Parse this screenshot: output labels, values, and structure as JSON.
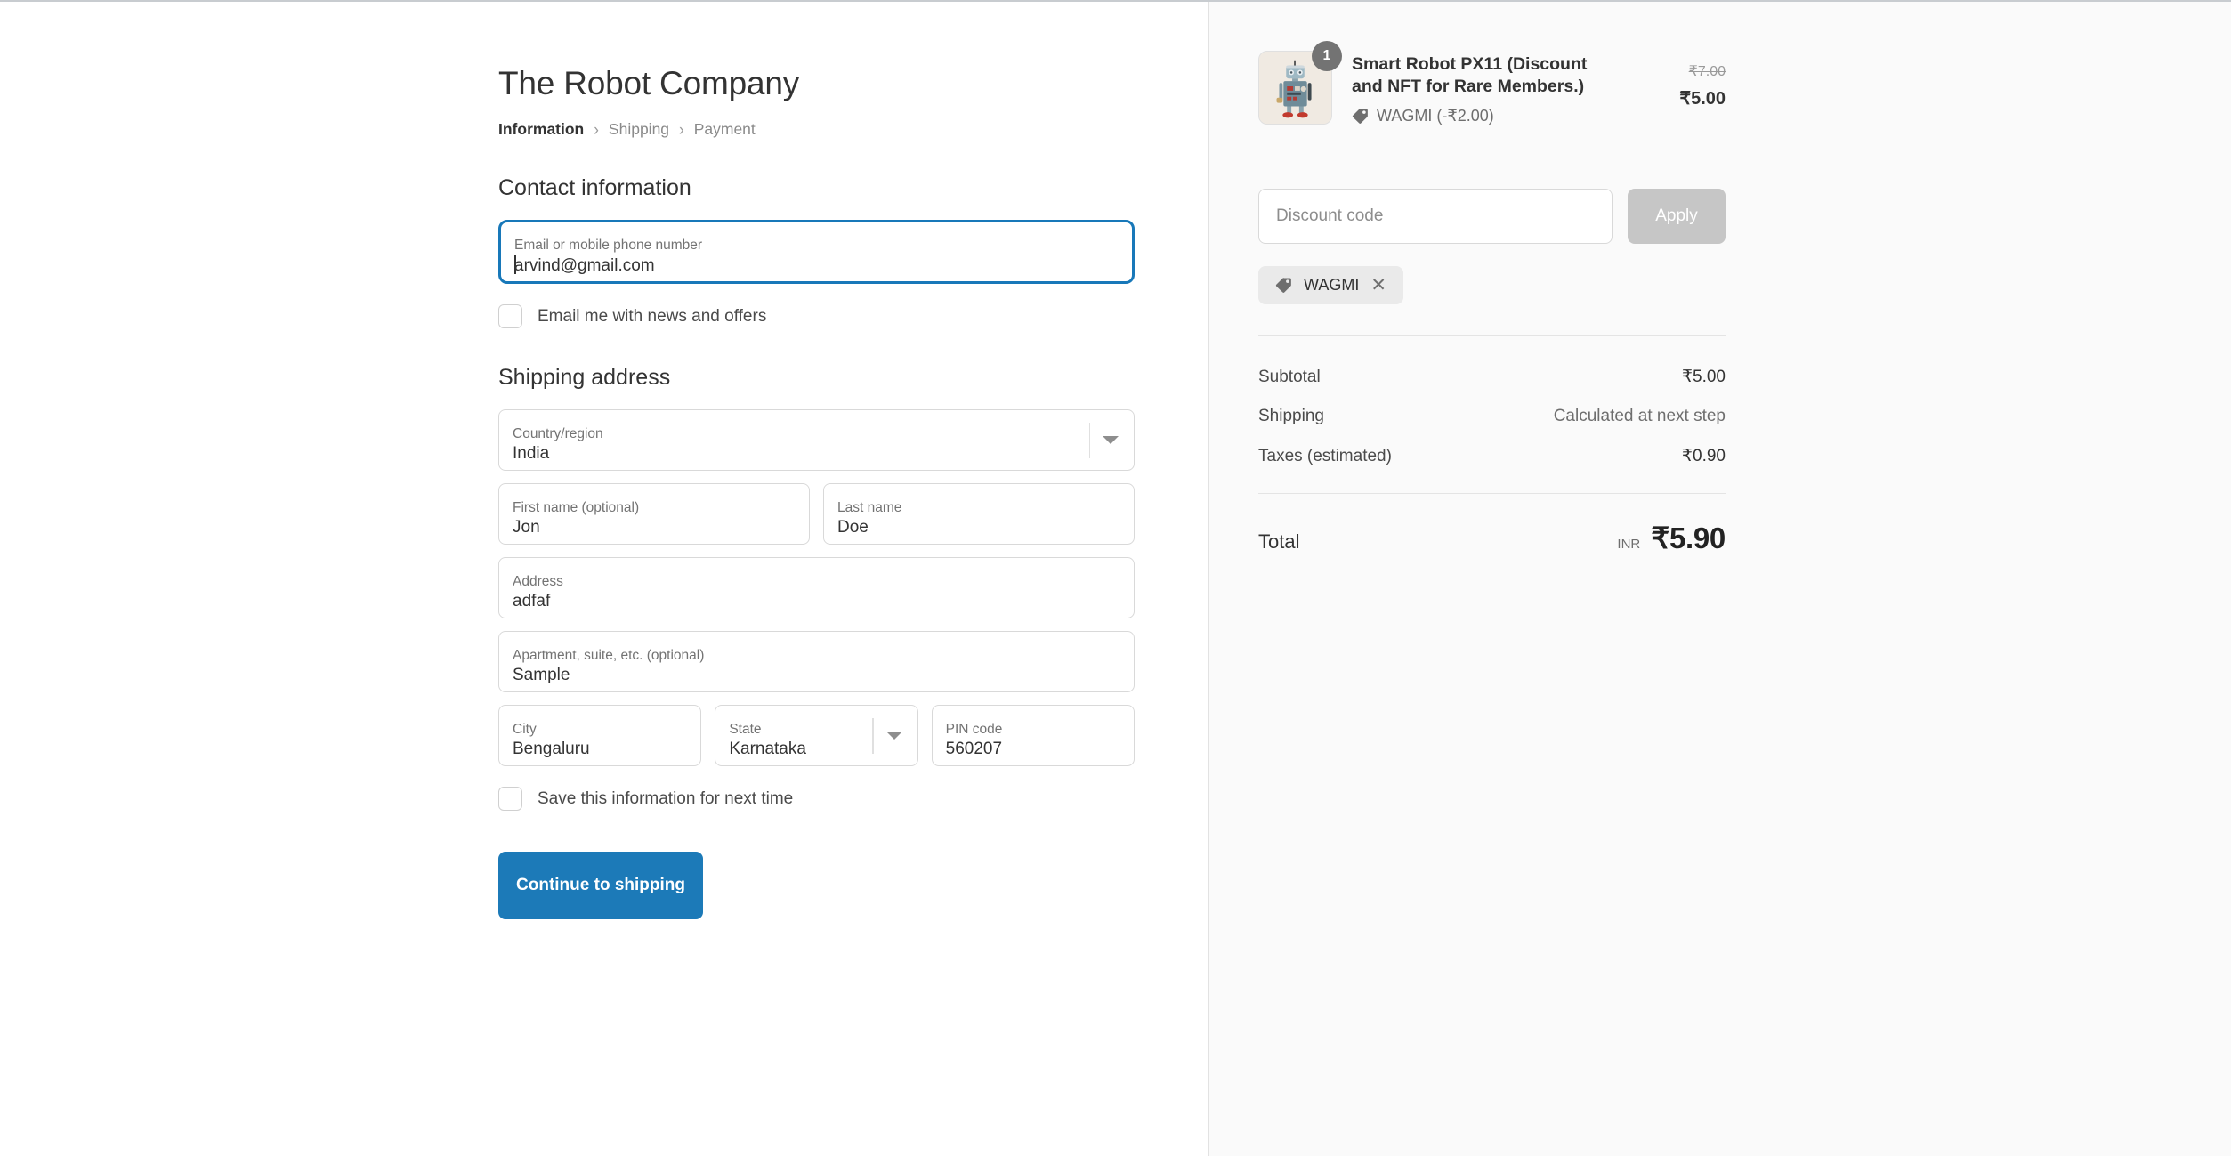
{
  "shop": {
    "title": "The Robot Company"
  },
  "breadcrumb": {
    "items": [
      {
        "label": "Information",
        "current": true
      },
      {
        "label": "Shipping",
        "current": false
      },
      {
        "label": "Payment",
        "current": false
      }
    ],
    "separator": "›"
  },
  "contact": {
    "heading": "Contact information",
    "email_field": {
      "label": "Email or mobile phone number",
      "value": "arvind@gmail.com",
      "focused": true
    },
    "newsletter_checkbox": {
      "label": "Email me with news and offers",
      "checked": false
    }
  },
  "shipping": {
    "heading": "Shipping address",
    "country": {
      "label": "Country/region",
      "value": "India"
    },
    "first_name": {
      "label": "First name (optional)",
      "value": "Jon"
    },
    "last_name": {
      "label": "Last name",
      "value": "Doe"
    },
    "address": {
      "label": "Address",
      "value": "adfaf"
    },
    "apartment": {
      "label": "Apartment, suite, etc. (optional)",
      "value": "Sample"
    },
    "city": {
      "label": "City",
      "value": "Bengaluru"
    },
    "state": {
      "label": "State",
      "value": "Karnataka"
    },
    "pin": {
      "label": "PIN code",
      "value": "560207"
    },
    "save_checkbox": {
      "label": "Save this information for next time",
      "checked": false
    },
    "submit_label": "Continue to shipping"
  },
  "summary": {
    "product": {
      "name": "Smart Robot PX11 (Discount and NFT for Rare Members.)",
      "quantity": "1",
      "discount_label": "WAGMI (-₹2.00)",
      "price_original": "₹7.00",
      "price_current": "₹5.00",
      "image_alt": "vintage-toy-robot"
    },
    "discount": {
      "placeholder": "Discount code",
      "value": "",
      "apply_label": "Apply",
      "applied_codes": [
        {
          "label": "WAGMI",
          "remove": "✕"
        }
      ]
    },
    "totals": [
      {
        "label": "Subtotal",
        "value": "₹5.00",
        "muted": false
      },
      {
        "label": "Shipping",
        "value": "Calculated at next step",
        "muted": true
      },
      {
        "label": "Taxes (estimated)",
        "value": "₹0.90",
        "muted": false
      }
    ],
    "grand_total": {
      "label": "Total",
      "currency": "INR",
      "value": "₹5.90"
    }
  },
  "colors": {
    "accent": "#1c7ab8",
    "focus_border": "#1878b9",
    "summary_bg": "#fafafa",
    "badge": "#737373"
  }
}
